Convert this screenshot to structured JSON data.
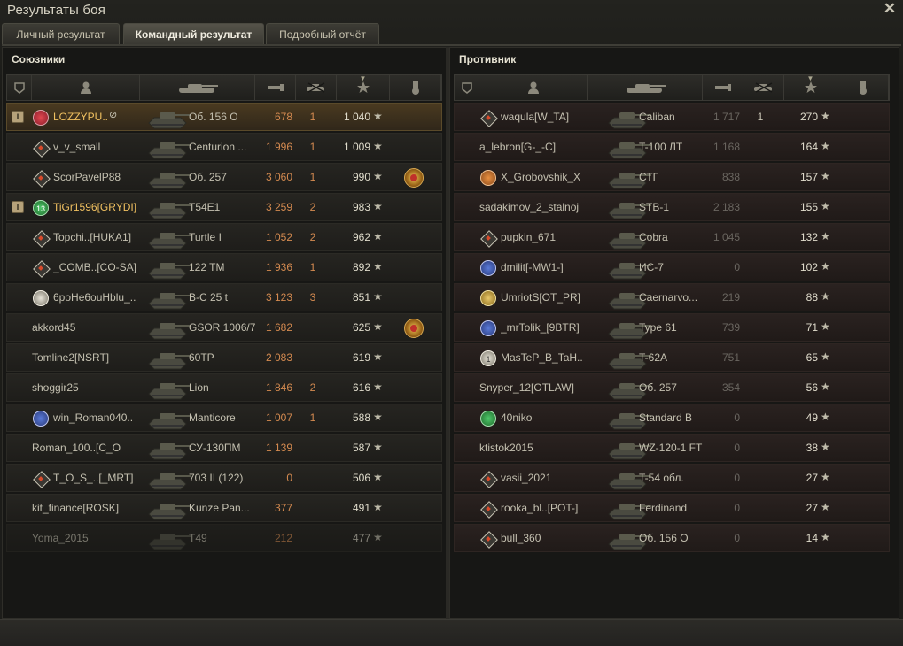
{
  "window": {
    "title": "Результаты боя"
  },
  "tabs": [
    {
      "label": "Личный результат",
      "active": false
    },
    {
      "label": "Командный результат",
      "active": true
    },
    {
      "label": "Подробный отчёт",
      "active": false
    }
  ],
  "allies": {
    "title": "Союзники",
    "players": [
      {
        "name": "LOZZYPU..",
        "tank": "Об. 156 О",
        "damage": "678",
        "kills": "1",
        "xp": "1 040",
        "badge": "red",
        "squad": "I",
        "self": true,
        "hidden": true
      },
      {
        "name": "v_v_small",
        "tank": "Centurion ...",
        "damage": "1 996",
        "kills": "1",
        "xp": "1 009",
        "badge": "diamond"
      },
      {
        "name": "ScorPavelP88",
        "tank": "Об. 257",
        "damage": "3 060",
        "kills": "1",
        "xp": "990",
        "badge": "diamond",
        "medal": true
      },
      {
        "name": "TiGr1596[GRYDI]",
        "tank": "T54E1",
        "damage": "3 259",
        "kills": "2",
        "xp": "983",
        "badge": "green",
        "badge_text": "13",
        "squad": "I",
        "squadmate": true
      },
      {
        "name": "Topchi..[HUKA1]",
        "tank": "Turtle I",
        "damage": "1 052",
        "kills": "2",
        "xp": "962",
        "badge": "diamond"
      },
      {
        "name": "_COMB..[CO-SA]",
        "tank": "122 TM",
        "damage": "1 936",
        "kills": "1",
        "xp": "892",
        "badge": "diamond"
      },
      {
        "name": "6poHe6ouHblu_..",
        "tank": "B-C 25 t",
        "damage": "3 123",
        "kills": "3",
        "xp": "851",
        "badge": "white"
      },
      {
        "name": "akkord45",
        "tank": "GSOR 1006/7",
        "damage": "1 682",
        "kills": "",
        "xp": "625",
        "medal": true
      },
      {
        "name": "Tomline2[NSRT]",
        "tank": "60TP",
        "damage": "2 083",
        "kills": "",
        "xp": "619"
      },
      {
        "name": "shoggir25",
        "tank": "Lion",
        "damage": "1 846",
        "kills": "2",
        "xp": "616"
      },
      {
        "name": "win_Roman040..",
        "tank": "Manticore",
        "damage": "1 007",
        "kills": "1",
        "xp": "588",
        "badge": "blue"
      },
      {
        "name": "Roman_100..[C_OLD]",
        "tank": "СУ-130ПМ",
        "damage": "1 139",
        "kills": "",
        "xp": "587"
      },
      {
        "name": "T_O_S_..[_MRT]",
        "tank": "703 II (122)",
        "damage": "0",
        "kills": "",
        "xp": "506",
        "badge": "diamond"
      },
      {
        "name": "kit_finance[ROSK]",
        "tank": "Kunze Pan...",
        "damage": "377",
        "kills": "",
        "xp": "491"
      },
      {
        "name": "Yoma_2015",
        "tank": "T49",
        "damage": "212",
        "kills": "",
        "xp": "477",
        "dead": true
      }
    ]
  },
  "enemies": {
    "title": "Противник",
    "players": [
      {
        "name": "waqula[W_TA]",
        "tank": "Caliban",
        "damage": "1 717",
        "kills": "1",
        "xp": "270",
        "badge": "diamond"
      },
      {
        "name": "a_lebron[G-_-C]",
        "tank": "T-100 ЛТ",
        "damage": "1 168",
        "kills": "",
        "xp": "164"
      },
      {
        "name": "X_Grobovshik_X",
        "tank": "СТГ",
        "damage": "838",
        "kills": "",
        "xp": "157",
        "badge": "orange"
      },
      {
        "name": "sadakimov_2_stalnoj",
        "tank": "STB-1",
        "damage": "2 183",
        "kills": "",
        "xp": "155"
      },
      {
        "name": "pupkin_671",
        "tank": "Cobra",
        "damage": "1 045",
        "kills": "",
        "xp": "132",
        "badge": "diamond"
      },
      {
        "name": "dmilit[-MW1-]",
        "tank": "ИС-7",
        "damage": "0",
        "kills": "",
        "xp": "102",
        "badge": "blue"
      },
      {
        "name": "UmriotS[OT_PR]",
        "tank": "Caernarvo...",
        "damage": "219",
        "kills": "",
        "xp": "88",
        "badge": "gold"
      },
      {
        "name": "_mrTolik_[9BTR]",
        "tank": "Type 61",
        "damage": "739",
        "kills": "",
        "xp": "71",
        "badge": "blue"
      },
      {
        "name": "MasTeP_B_TaH..",
        "tank": "T-62A",
        "damage": "751",
        "kills": "",
        "xp": "65",
        "badge": "white",
        "badge_text": "1"
      },
      {
        "name": "Snyper_12[OTLAW]",
        "tank": "Об. 257",
        "damage": "354",
        "kills": "",
        "xp": "56"
      },
      {
        "name": "40niko",
        "tank": "Standard B",
        "damage": "0",
        "kills": "",
        "xp": "49",
        "badge": "green"
      },
      {
        "name": "ktistok2015",
        "tank": "WZ-120-1 FT",
        "damage": "0",
        "kills": "",
        "xp": "38"
      },
      {
        "name": "vasii_2021",
        "tank": "T-54 обл.",
        "damage": "0",
        "kills": "",
        "xp": "27",
        "badge": "diamond"
      },
      {
        "name": "rooka_bl..[POT-]",
        "tank": "Ferdinand",
        "damage": "0",
        "kills": "",
        "xp": "27",
        "badge": "diamond"
      },
      {
        "name": "bull_360",
        "tank": "Об. 156 О",
        "damage": "0",
        "kills": "",
        "xp": "14",
        "badge": "diamond"
      }
    ]
  },
  "icons": {
    "close": "close-icon",
    "squad": "squad-icon",
    "player": "player-icon",
    "tank": "tank-icon",
    "damage": "damage-icon",
    "kills": "kills-icon",
    "xp": "star-icon",
    "medal": "medal-icon"
  },
  "colors": {
    "self_row": "#4a3a20",
    "squad_name": "#f0c060",
    "damage": "#d48a50",
    "enemy_row": "#2a2220"
  }
}
